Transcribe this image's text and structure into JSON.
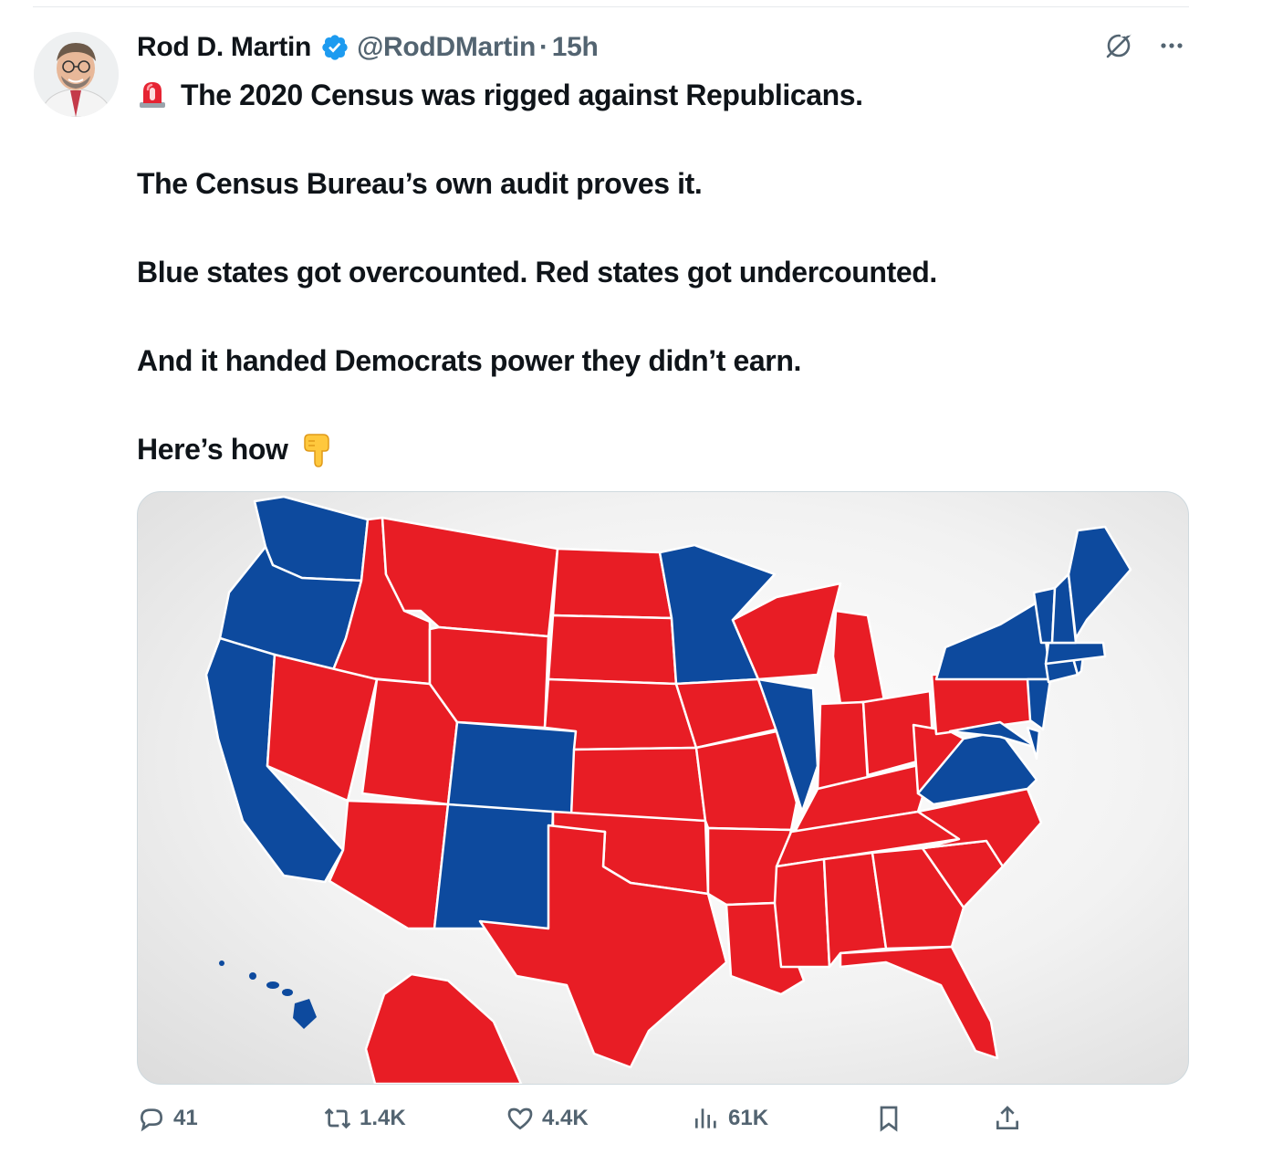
{
  "author": {
    "name": "Rod D. Martin",
    "handle": "@RodDMartin",
    "separator": "·",
    "time": "15h",
    "verified_color": "#1d9bf0"
  },
  "icons": {
    "verified": "verified-badge-icon",
    "grok": "grok-icon",
    "more": "more-icon",
    "siren": "police-light-emoji",
    "point_down": "backhand-index-pointing-down-emoji"
  },
  "tweet": {
    "line1": "The 2020 Census was rigged against Republicans.",
    "line2": "The Census Bureau’s own audit proves it.",
    "line3": "Blue states got overcounted. Red states got undercounted.",
    "line4": "And it handed Democrats power they didn’t earn.",
    "line5": "Here’s how"
  },
  "map": {
    "red_color": "#e81d25",
    "blue_color": "#0d4a9e",
    "blue_states": [
      "WA",
      "OR",
      "CA",
      "CO",
      "NM",
      "MN",
      "IL",
      "VA",
      "NY",
      "VT",
      "NH",
      "ME",
      "MA",
      "CT",
      "RI",
      "NJ",
      "DE",
      "MD",
      "HI"
    ]
  },
  "actions": {
    "replies": "41",
    "reposts": "1.4K",
    "likes": "4.4K",
    "views": "61K"
  }
}
